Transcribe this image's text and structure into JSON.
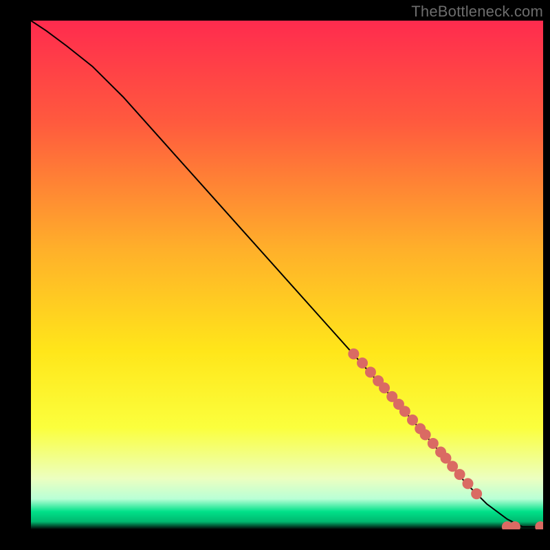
{
  "watermark": "TheBottleneck.com",
  "chart_data": {
    "type": "line",
    "title": "",
    "xlabel": "",
    "ylabel": "",
    "xlim": [
      0,
      100
    ],
    "ylim": [
      0,
      100
    ],
    "gradient_stops": [
      {
        "offset": 0.0,
        "color": "#ff2b4e"
      },
      {
        "offset": 0.2,
        "color": "#ff5a3e"
      },
      {
        "offset": 0.45,
        "color": "#ffb02a"
      },
      {
        "offset": 0.65,
        "color": "#ffe61a"
      },
      {
        "offset": 0.8,
        "color": "#fbff3d"
      },
      {
        "offset": 0.9,
        "color": "#ecffc0"
      },
      {
        "offset": 0.94,
        "color": "#b9ffd6"
      },
      {
        "offset": 0.965,
        "color": "#00e189"
      },
      {
        "offset": 0.985,
        "color": "#00b86f"
      },
      {
        "offset": 1.0,
        "color": "#000000"
      }
    ],
    "series": [
      {
        "name": "curve",
        "style": "line",
        "color": "#000000",
        "x": [
          0,
          3,
          7,
          12,
          18,
          26,
          34,
          42,
          50,
          58,
          66,
          74,
          80,
          85,
          89,
          93,
          96,
          100
        ],
        "y": [
          100,
          98,
          95,
          91,
          85,
          76,
          67,
          58,
          49,
          40,
          31,
          22,
          15,
          9,
          5,
          2,
          0.5,
          0.5
        ]
      },
      {
        "name": "dots",
        "style": "marker",
        "color": "#da6a63",
        "radius": 8,
        "x": [
          63,
          64.7,
          66.3,
          67.8,
          69,
          70.5,
          71.8,
          73,
          74.5,
          76,
          77,
          78.5,
          80,
          81,
          82.3,
          83.7,
          85.3,
          87,
          93,
          94.5,
          99.5
        ],
        "y": [
          34.5,
          32.7,
          30.9,
          29.2,
          27.8,
          26.1,
          24.6,
          23.2,
          21.5,
          19.8,
          18.6,
          16.9,
          15.2,
          14,
          12.4,
          10.8,
          9.0,
          7.0,
          0.5,
          0.5,
          0.5
        ]
      }
    ]
  }
}
